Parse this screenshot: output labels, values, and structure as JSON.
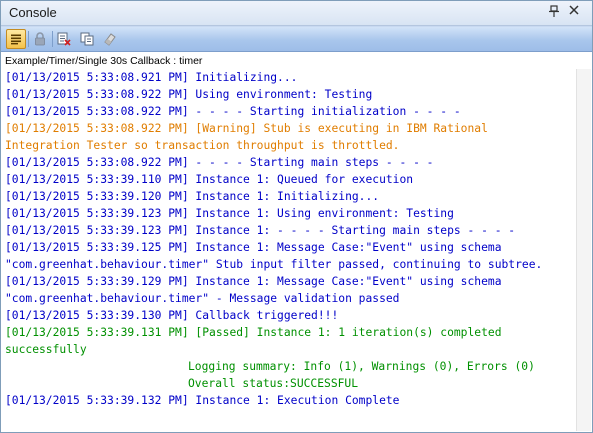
{
  "panel": {
    "title": "Console",
    "pin_icon": "pin-icon",
    "close_icon": "close-icon"
  },
  "toolbar": {
    "buttons": [
      {
        "icon": "word-wrap-icon",
        "active": true
      },
      {
        "icon": "lock-icon",
        "active": false
      },
      {
        "icon": "clear-console-icon",
        "active": false
      },
      {
        "icon": "copy-icon",
        "active": false
      },
      {
        "icon": "eraser-icon",
        "active": false
      }
    ]
  },
  "path": "Example/Timer/Single 30s Callback : timer",
  "colors": {
    "info": "#0000c8",
    "warning": "#e07d00",
    "passed": "#009000"
  },
  "log": [
    {
      "text": "[01/13/2015 5:33:08.921 PM] Initializing...",
      "level": "info"
    },
    {
      "text": "[01/13/2015 5:33:08.922 PM] Using environment: Testing",
      "level": "info"
    },
    {
      "text": "[01/13/2015 5:33:08.922 PM] - - - - Starting initialization - - - -",
      "level": "info"
    },
    {
      "text": "[01/13/2015 5:33:08.922 PM] [Warning] Stub is executing in IBM Rational",
      "level": "warning"
    },
    {
      "text": "Integration Tester so transaction throughput is throttled.",
      "level": "warning"
    },
    {
      "text": "[01/13/2015 5:33:08.922 PM] - - - - Starting main steps - - - -",
      "level": "info"
    },
    {
      "text": "[01/13/2015 5:33:39.110 PM] Instance 1: Queued for execution",
      "level": "info"
    },
    {
      "text": "[01/13/2015 5:33:39.120 PM] Instance 1: Initializing...",
      "level": "info"
    },
    {
      "text": "[01/13/2015 5:33:39.123 PM] Instance 1: Using environment: Testing",
      "level": "info"
    },
    {
      "text": "[01/13/2015 5:33:39.123 PM] Instance 1: - - - - Starting main steps - - - -",
      "level": "info"
    },
    {
      "text": "[01/13/2015 5:33:39.125 PM] Instance 1: Message Case:\"Event\" using schema",
      "level": "info"
    },
    {
      "text": "\"com.greenhat.behaviour.timer\" Stub input filter passed, continuing to subtree.",
      "level": "info"
    },
    {
      "text": "[01/13/2015 5:33:39.129 PM] Instance 1: Message Case:\"Event\" using schema",
      "level": "info"
    },
    {
      "text": "\"com.greenhat.behaviour.timer\" - Message validation passed",
      "level": "info"
    },
    {
      "text": "[01/13/2015 5:33:39.130 PM] Callback triggered!!!",
      "level": "info"
    },
    {
      "text": "[01/13/2015 5:33:39.131 PM] [Passed] Instance 1: 1 iteration(s) completed",
      "level": "passed"
    },
    {
      "text": "successfully",
      "level": "passed"
    },
    {
      "text": "Logging summary: Info (1), Warnings (0), Errors (0)",
      "level": "passed",
      "indent": true
    },
    {
      "text": "Overall status:SUCCESSFUL",
      "level": "passed",
      "indent": true
    },
    {
      "text": "[01/13/2015 5:33:39.132 PM] Instance 1: Execution Complete",
      "level": "info"
    }
  ]
}
